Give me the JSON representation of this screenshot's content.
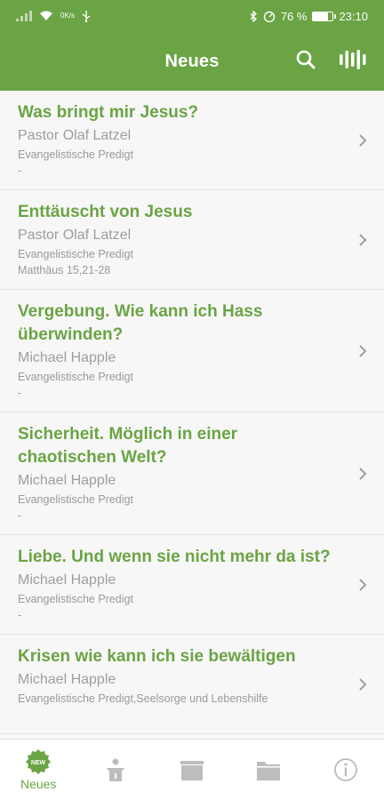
{
  "status_bar": {
    "data_up": "0",
    "data_unit": "K/s",
    "battery_percent": "76 %",
    "battery_level": 0.76,
    "time": "23:10"
  },
  "app_bar": {
    "title": "Neues",
    "search_icon": "search-icon",
    "audio_icon": "audio-bars-icon"
  },
  "sermons": [
    {
      "title": "Was bringt mir Jesus?",
      "author": "Pastor Olaf Latzel",
      "category": "Evangelistische Predigt",
      "reference": "-"
    },
    {
      "title": "Enttäuscht von Jesus",
      "author": "Pastor Olaf Latzel",
      "category": "Evangelistische Predigt",
      "reference": "Matthäus 15,21-28"
    },
    {
      "title": "Vergebung. Wie kann ich Hass überwinden?",
      "author": "Michael Happle",
      "category": "Evangelistische Predigt",
      "reference": "-"
    },
    {
      "title": "Sicherheit. Möglich in einer chaotischen Welt?",
      "author": "Michael Happle",
      "category": "Evangelistische Predigt",
      "reference": "-"
    },
    {
      "title": "Liebe. Und wenn sie nicht mehr da ist?",
      "author": "Michael Happle",
      "category": "Evangelistische Predigt",
      "reference": "-"
    },
    {
      "title": "Krisen wie kann ich sie bewältigen",
      "author": "Michael Happle",
      "category": "Evangelistische Predigt,Seelsorge und Lebenshilfe",
      "reference": ""
    }
  ],
  "bottom_nav": {
    "items": [
      {
        "label": "Neues",
        "icon": "new-badge-icon",
        "active": true
      },
      {
        "label": "",
        "icon": "pulpit-icon",
        "active": false
      },
      {
        "label": "",
        "icon": "box-icon",
        "active": false
      },
      {
        "label": "",
        "icon": "folder-icon",
        "active": false
      },
      {
        "label": "",
        "icon": "info-icon",
        "active": false
      }
    ]
  },
  "colors": {
    "brand_green": "#6aa444",
    "muted_gray": "#9e9e9e",
    "inactive_icon": "#bdbdbd"
  }
}
